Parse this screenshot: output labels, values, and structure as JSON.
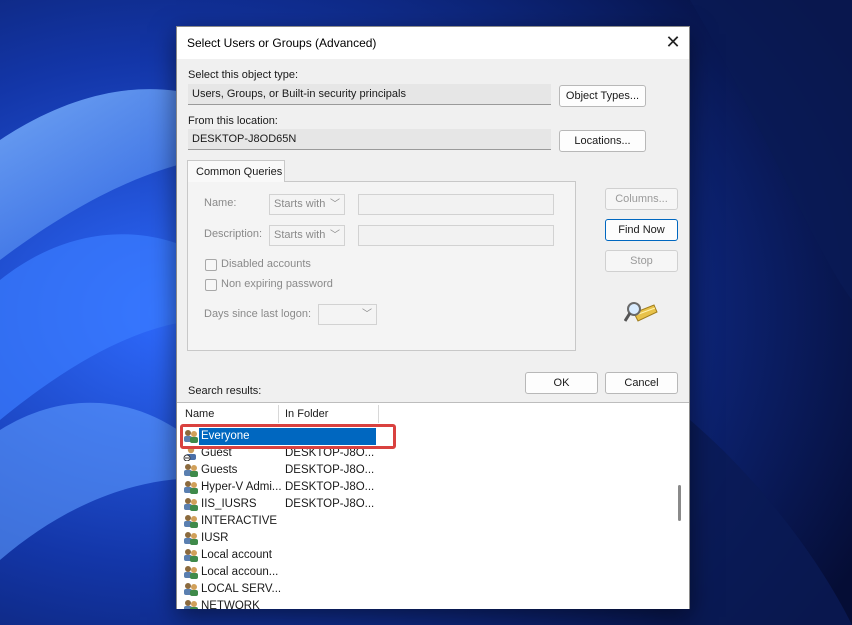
{
  "dialog": {
    "title": "Select Users or Groups (Advanced)",
    "close_glyph": "✕",
    "object_type_label": "Select this object type:",
    "object_type_value": "Users, Groups, or Built-in security principals",
    "object_types_button": "Object Types...",
    "location_label": "From this location:",
    "location_value": "DESKTOP-J8OD65N",
    "locations_button": "Locations..."
  },
  "queries": {
    "tab_label": "Common Queries",
    "name_label": "Name:",
    "name_mode": "Starts with",
    "description_label": "Description:",
    "description_mode": "Starts with",
    "disabled_accounts": "Disabled accounts",
    "non_expiring_password": "Non expiring password",
    "days_label": "Days since last logon:"
  },
  "side_buttons": {
    "columns": "Columns...",
    "find_now": "Find Now",
    "stop": "Stop",
    "search_icon": "magnifier-over-folder-icon"
  },
  "footer": {
    "ok": "OK",
    "cancel": "Cancel",
    "results_label": "Search results:"
  },
  "results": {
    "columns": [
      "Name",
      "In Folder"
    ],
    "rows": [
      {
        "name": "Everyone",
        "folder": "",
        "selected": true,
        "icon": "group-icon"
      },
      {
        "name": "Guest",
        "folder": "DESKTOP-J8O...",
        "selected": false,
        "icon": "user-icon"
      },
      {
        "name": "Guests",
        "folder": "DESKTOP-J8O...",
        "selected": false,
        "icon": "group-icon"
      },
      {
        "name": "Hyper-V Admi...",
        "folder": "DESKTOP-J8O...",
        "selected": false,
        "icon": "group-icon"
      },
      {
        "name": "IIS_IUSRS",
        "folder": "DESKTOP-J8O...",
        "selected": false,
        "icon": "group-icon"
      },
      {
        "name": "INTERACTIVE",
        "folder": "",
        "selected": false,
        "icon": "group-icon"
      },
      {
        "name": "IUSR",
        "folder": "",
        "selected": false,
        "icon": "group-icon"
      },
      {
        "name": "Local account",
        "folder": "",
        "selected": false,
        "icon": "group-icon"
      },
      {
        "name": "Local accoun...",
        "folder": "",
        "selected": false,
        "icon": "group-icon"
      },
      {
        "name": "LOCAL SERV...",
        "folder": "",
        "selected": false,
        "icon": "group-icon"
      },
      {
        "name": "NETWORK",
        "folder": "",
        "selected": false,
        "icon": "group-icon"
      }
    ]
  },
  "colors": {
    "selection": "#0067c0",
    "highlight_box": "#d9413f",
    "wallpaper": "#0b1f6b"
  }
}
